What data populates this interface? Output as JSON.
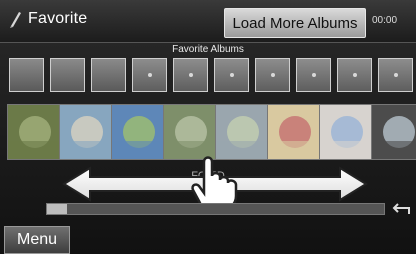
{
  "header": {
    "title": "Favorite",
    "load_more_label": "Load More Albums",
    "time": "00:00"
  },
  "section_title": "Favorite Albums",
  "mini_items": [
    {
      "name": "mini-album-1",
      "filled": true
    },
    {
      "name": "mini-album-2",
      "filled": true
    },
    {
      "name": "mini-album-3",
      "filled": true
    },
    {
      "name": "mini-album-4",
      "filled": false
    },
    {
      "name": "mini-album-5",
      "filled": false
    },
    {
      "name": "mini-album-6",
      "filled": false
    },
    {
      "name": "mini-album-7",
      "filled": false
    },
    {
      "name": "mini-album-8",
      "filled": false
    },
    {
      "name": "mini-album-9",
      "filled": false
    },
    {
      "name": "mini-album-10",
      "filled": false
    }
  ],
  "albums": [
    {
      "name": "album-1",
      "icon": "leaf-icon"
    },
    {
      "name": "album-2",
      "icon": "beach-chair-icon"
    },
    {
      "name": "album-3",
      "icon": "landscape-icon"
    },
    {
      "name": "album-4",
      "icon": "tree-icon"
    },
    {
      "name": "album-5",
      "icon": "flowers-icon"
    },
    {
      "name": "album-6",
      "icon": "bouquet-icon"
    },
    {
      "name": "album-7",
      "icon": "bouquet-white-icon"
    },
    {
      "name": "album-8",
      "icon": "bird-icon"
    }
  ],
  "overlay": {
    "line1": "FO          ED",
    "line2": "RI          D"
  },
  "progress": 0.06,
  "footer": {
    "menu_label": "Menu"
  }
}
